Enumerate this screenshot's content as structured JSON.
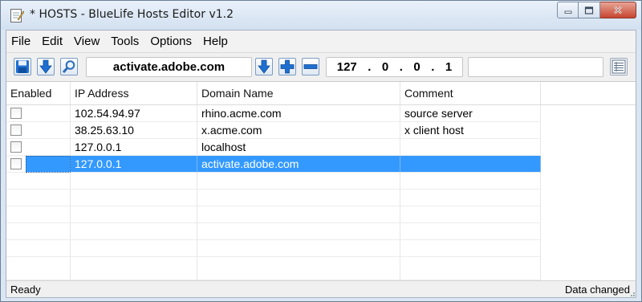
{
  "window": {
    "title": "* HOSTS - BlueLife Hosts Editor v1.2"
  },
  "menu": [
    "File",
    "Edit",
    "View",
    "Tools",
    "Options",
    "Help"
  ],
  "toolbar": {
    "domain_value": "activate.adobe.com",
    "ip_octets": [
      "127",
      "0",
      "0",
      "1"
    ],
    "comment_value": ""
  },
  "table": {
    "columns": [
      "Enabled",
      "IP Address",
      "Domain Name",
      "Comment"
    ],
    "rows": [
      {
        "enabled": false,
        "ip": "102.54.94.97",
        "domain": "rhino.acme.com",
        "comment": "source server",
        "selected": false
      },
      {
        "enabled": false,
        "ip": "38.25.63.10",
        "domain": "x.acme.com",
        "comment": "x client host",
        "selected": false
      },
      {
        "enabled": false,
        "ip": "127.0.0.1",
        "domain": "localhost",
        "comment": "",
        "selected": false
      },
      {
        "enabled": false,
        "ip": "127.0.0.1",
        "domain": "activate.adobe.com",
        "comment": "",
        "selected": true
      }
    ]
  },
  "status": {
    "left": "Ready",
    "right": "Data changed"
  },
  "colors": {
    "selection": "#3399ff",
    "toolbar_icon_blue": "#1f6fd1"
  },
  "icons": [
    "notepad-icon",
    "save-icon",
    "download-arrow-icon",
    "search-icon",
    "down-arrow-icon",
    "plus-icon",
    "minus-icon",
    "list-view-icon"
  ]
}
